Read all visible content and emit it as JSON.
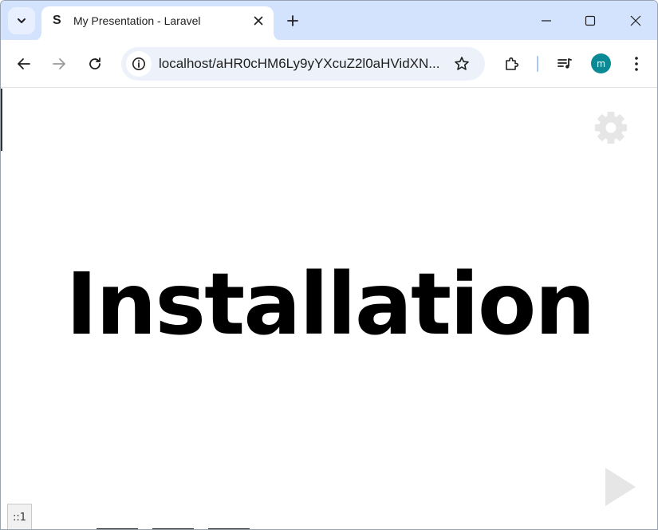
{
  "browser": {
    "tab": {
      "favicon_letter": "S",
      "title": "My Presentation - Laravel"
    },
    "address_bar": {
      "url": "localhost/aHR0cHM6Ly9yYXcuZ2l0aHVidXN..."
    },
    "profile_initial": "m",
    "icons": {
      "tab_search": "chevron-down-icon",
      "tab_close": "close-icon",
      "new_tab": "plus-icon",
      "minimize": "minimize-icon",
      "maximize": "maximize-icon",
      "close_window": "close-icon",
      "back": "arrow-left-icon",
      "forward": "arrow-right-icon",
      "reload": "reload-icon",
      "site_info": "info-icon",
      "bookmark": "star-icon",
      "extensions": "puzzle-icon",
      "media": "playlist-icon",
      "menu": "kebab-menu-icon"
    },
    "colors": {
      "tabstrip": "#d3e3fd",
      "omnibox": "#edf2fa",
      "avatar": "#0b8a96"
    }
  },
  "slide": {
    "heading": "Installation",
    "status_tag": "::1",
    "icons": {
      "settings": "gear-icon",
      "next": "play-triangle-icon"
    }
  }
}
